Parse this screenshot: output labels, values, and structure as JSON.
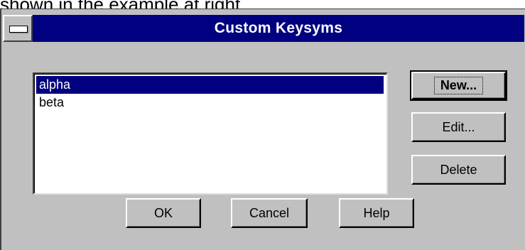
{
  "caption": "shown in the example at right.",
  "dialog": {
    "title": "Custom Keysyms",
    "list": {
      "items": [
        {
          "label": "alpha",
          "selected": true
        },
        {
          "label": "beta",
          "selected": false
        }
      ]
    },
    "buttons": {
      "new": "New...",
      "edit": "Edit...",
      "delete": "Delete",
      "ok": "OK",
      "cancel": "Cancel",
      "help": "Help"
    }
  },
  "colors": {
    "titlebar": "#000080",
    "face": "#c0c0c0",
    "selection": "#000080"
  },
  "icons": {
    "system_menu": "system-menu-icon"
  }
}
